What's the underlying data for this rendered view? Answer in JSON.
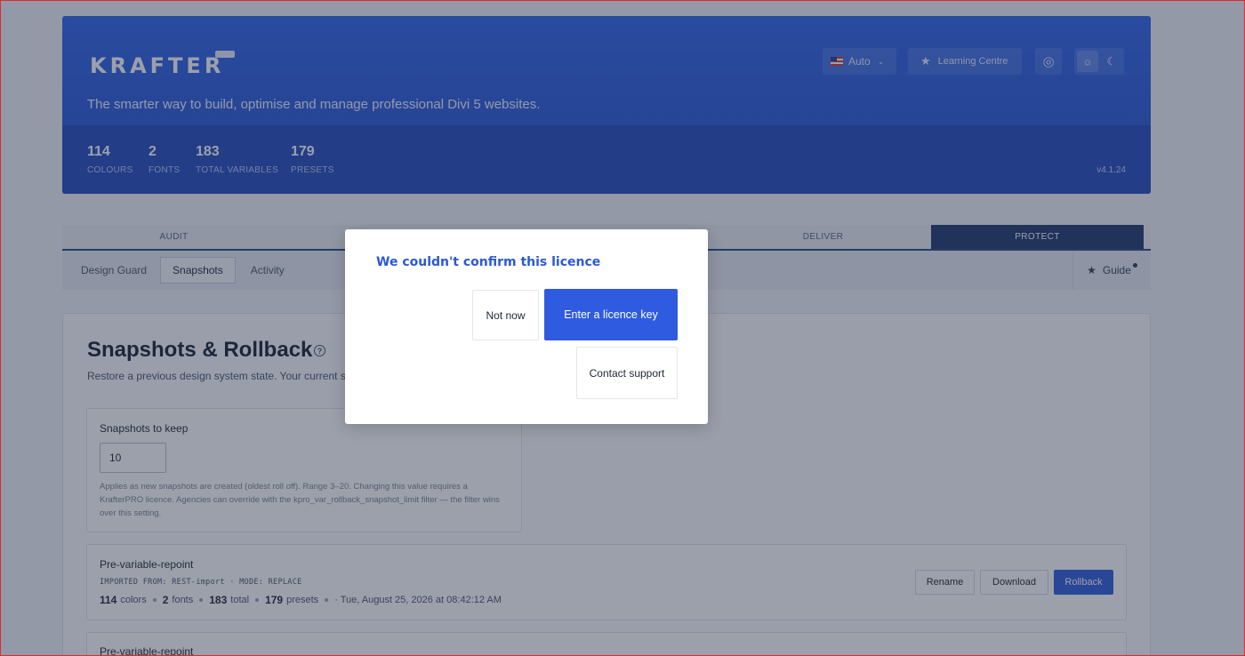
{
  "header": {
    "logo": "KRAFTER",
    "tagline": "The smarter way to build, optimise and manage professional Divi 5 websites.",
    "language": "Auto",
    "learning_centre": "Learning Centre",
    "version": "v4.1.24",
    "stats": [
      {
        "num": "114",
        "label": "COLOURS"
      },
      {
        "num": "2",
        "label": "FONTS"
      },
      {
        "num": "183",
        "label": "TOTAL VARIABLES"
      },
      {
        "num": "179",
        "label": "PRESETS"
      }
    ]
  },
  "tabs": [
    "AUDIT",
    "DELIVER",
    "PROTECT"
  ],
  "subnav": {
    "items": [
      "Design Guard",
      "Snapshots",
      "Activity"
    ],
    "guide": "Guide"
  },
  "main": {
    "title": "Snapshots & Rollback",
    "subtitle": "Restore a previous design system state. Your current st",
    "keep_label": "Snapshots to keep",
    "keep_value": "10",
    "keep_help": "Applies as new snapshots are created (oldest roll off). Range 3–20. Changing this value requires a KrafterPRO licence. Agencies can override with the kpro_var_rollback_snapshot_limit filter — the filter wins over this setting."
  },
  "snapshots": [
    {
      "name": "Pre-variable-repoint",
      "meta": "IMPORTED FROM: REST-import  ·  MODE: REPLACE",
      "colors_num": "114",
      "colors_lbl": "colors",
      "fonts_num": "2",
      "fonts_lbl": "fonts",
      "total_num": "183",
      "total_lbl": "total",
      "presets_num": "179",
      "presets_lbl": "presets",
      "date": "· Tue, August 25, 2026 at 08:42:12 AM",
      "rename": "Rename",
      "download": "Download",
      "rollback": "Rollback"
    },
    {
      "name": "Pre-variable-repoint"
    }
  ],
  "modal": {
    "title": "We couldn't confirm this licence",
    "not_now": "Not now",
    "enter_key": "Enter a licence key",
    "contact": "Contact support"
  }
}
